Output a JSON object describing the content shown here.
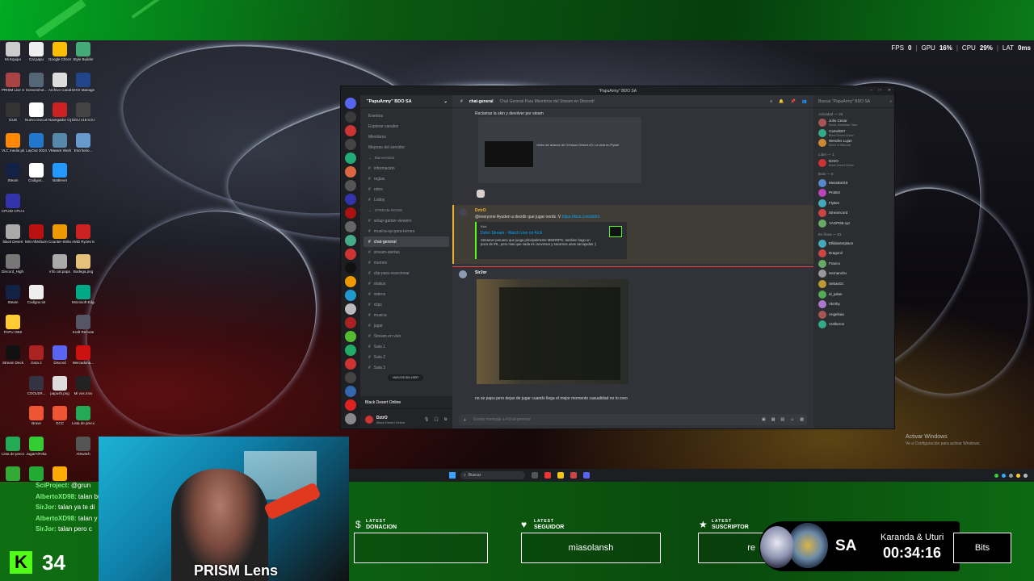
{
  "stats": {
    "fps_label": "FPS",
    "fps": "0",
    "gpu_label": "GPU",
    "gpu": "16%",
    "cpu_label": "CPU",
    "cpu": "29%",
    "lat_label": "LAT",
    "lat": "0ms"
  },
  "desktop": {
    "icons": [
      "Mi Equipo",
      "Cal.papu",
      "Google Chrome",
      "Style Builder",
      "PRISM Live Studio",
      "Screenshot...",
      "Archivo Canal...",
      "DIXX Manager",
      "iCUE",
      "Nuevo Documen...",
      "Navegador Opera GX",
      "DDU v18.0.8.6.exe",
      "VLC media player",
      "LayOut 2024",
      "VMware Workstat...",
      "Escritorio...",
      "Steam",
      "Codigos...",
      "Battlenet",
      "",
      "CPUID CPU-Z",
      "",
      "",
      "",
      "black Desert",
      "MSI Afterburner",
      "Counter-Strike Global Off...",
      "AMD Ryzen Master",
      "Discord_High...",
      "",
      "info cal.papa",
      "Bodega.png",
      "Steam",
      "Codigos.txt",
      "",
      "Microsoft Edge",
      "PAPU OBS",
      "",
      "",
      "Kraft Remote",
      "Stream Deck",
      "Dota 2",
      "Discord",
      "Mercadona...",
      "",
      "COOLER...",
      "papush.png",
      "Mi vos.mov",
      "",
      "Brave",
      "GCC",
      "Lista de precios Mi...",
      "Lista de precios Mi...",
      "JugarAlFeka",
      "",
      "AlSwitch",
      "Edit.reg",
      "Flanders Widescreen",
      "Imvu",
      "",
      "OBS Studio",
      "Punto de Venta Plus 5",
      "SketchUp 2024",
      "PRISM Lens",
      "",
      "Wowee",
      "Nueva carpeta",
      "papu 1.png",
      "File Maker.png",
      ""
    ],
    "activate_title": "Activar Windows",
    "activate_sub": "Ve a Configuración para activar Windows.",
    "taskbar_search": "Buscar"
  },
  "discord": {
    "window_title": "\"PapuArmy\" BDO SA",
    "server_name": "\"PapuArmy\" BDO SA",
    "top_items": [
      "Eventos",
      "Explorar canales",
      "Miembros",
      "Mejoras del servidor"
    ],
    "channels": [
      {
        "label": "Bienvenidos",
        "cat": true
      },
      {
        "label": "información"
      },
      {
        "label": "reglas"
      },
      {
        "label": "roles"
      },
      {
        "label": "Lobby"
      },
      {
        "label": "STREAM ROOM",
        "cat": true
      },
      {
        "label": "setup-gamer-viewers"
      },
      {
        "label": "musica-op-para-torneo"
      },
      {
        "label": "chat-general",
        "active": true
      },
      {
        "label": "stream-alertas"
      },
      {
        "label": "memes"
      },
      {
        "label": "clip-para-reaccionar"
      },
      {
        "label": "otakus"
      },
      {
        "label": "videos"
      },
      {
        "label": "clips"
      },
      {
        "label": "musica"
      },
      {
        "label": "jugar"
      },
      {
        "label": "Stream en vivo"
      },
      {
        "label": "Sala 1"
      },
      {
        "label": "Sala 2"
      },
      {
        "label": "Sala 3"
      }
    ],
    "new_unread": "NUEVOS SIN LEER",
    "voice_status": "Black Desert Online",
    "user_name": "DztrO",
    "user_status": "Black Desert Online",
    "channel_name": "chat-general",
    "channel_topic": "Chat General Para Miembros del Stream en Discord!",
    "msg1": "Reclamar la skin y devolver por steam",
    "embed1": "Video de avance de Crimson Desert #3: La vida en Pywel",
    "msg2_author": "DztrO",
    "msg2_text": "@everyone Ayuden a decidir que jugar nerds :V",
    "msg2_link": "https://kick.com/dztro",
    "msg2_site": "Kick",
    "msg2_embed_title": "Dztro Stream - Watch Live on Kick",
    "msg2_embed_desc": "Streamer peruano que juega principalmente MMORPG, tambien hago un poco de IRL, pero mas que nada es conversar y sacarnos unas carcajadas :)",
    "msg3_author": "SirJor",
    "msg3_text": "no se papu pero dejas de jugar cuando llega el mejor momento casualidad no lo creo",
    "input_placeholder": "Enviar mensaje a #chat-general",
    "member_search": "Buscar \"PapuArmy\" BDO SA",
    "activity_label": "Actividad — 20",
    "activities": [
      {
        "name": "Julio Cesar",
        "game": "Morat, Sebastian Yatra"
      },
      {
        "name": "Camel007",
        "game": "Black Desert Online"
      },
      {
        "name": "Wendes Lujan",
        "game": "World of Warcraft"
      }
    ],
    "lider_label": "Líder — 1",
    "lider": [
      {
        "name": "DztrO",
        "status": "Black Desert Online"
      }
    ],
    "bots_label": "Bots — 5",
    "bots": [
      "MessBotSS",
      "ProBot",
      "FlyBot",
      "Streamcord",
      "YAGPDB.xyz"
    ],
    "online_label": "En línea — 81",
    "online": [
      "Elliidasterplace",
      "Dragonil",
      "Franco",
      "Hernancho",
      "SebasGc",
      "el_julian",
      "Akrshy",
      "Angelsaa",
      "Arelkeron"
    ]
  },
  "overlay": {
    "chat": [
      {
        "user": "SciProject:",
        "text": "@grun"
      },
      {
        "user": "AlbertoXD98:",
        "text": "talan bus"
      },
      {
        "user": "SirJor:",
        "text": "talan ya te di"
      },
      {
        "user": "AlbertoXD98:",
        "text": "talan y el"
      },
      {
        "user": "SirJor:",
        "text": "talan pero c"
      }
    ],
    "kick_logo": "K",
    "viewer_count": "34",
    "cam_label": "PRISM Lens",
    "donation_small": "LATEST",
    "donation_title": "DONACION",
    "donation_value": "",
    "follower_small": "LATEST",
    "follower_title": "SEGUIDOR",
    "follower_value": "miasolansh",
    "sub_small": "LATEST",
    "sub_title": "SUSCRIPTOR",
    "sub_value": "re",
    "bits_value": "Bits",
    "sa": "SA",
    "timer_names": "Karanda & Uturi",
    "timer": "00:34:16"
  }
}
